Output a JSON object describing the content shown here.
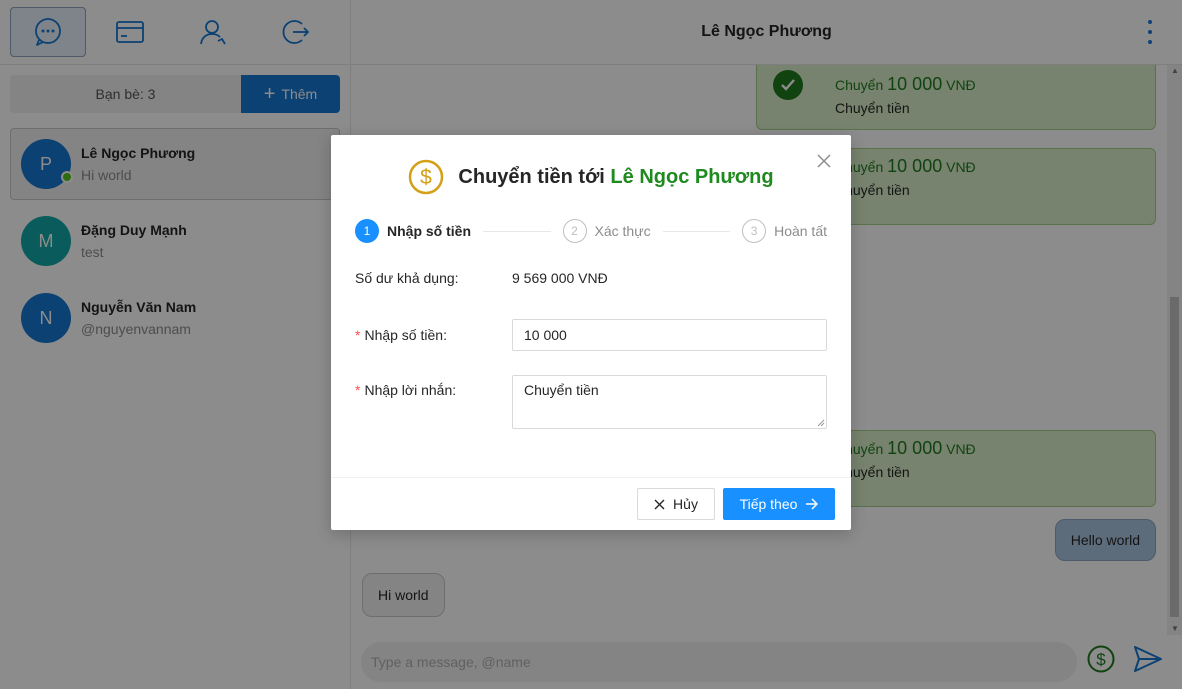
{
  "sidebar": {
    "friends_label": "Bạn bè: 3",
    "add_label": "Thêm",
    "contacts": [
      {
        "initial": "P",
        "name": "Lê Ngọc Phương",
        "sub": "Hi world",
        "color": "#1677d2",
        "online": true
      },
      {
        "initial": "M",
        "name": "Đặng Duy Mạnh",
        "sub": "test",
        "color": "#13a8a8",
        "online": false
      },
      {
        "initial": "N",
        "name": "Nguyễn Văn Nam",
        "sub": "@nguyenvannam",
        "color": "#1677d2",
        "online": false
      }
    ]
  },
  "chat": {
    "title": "Lê Ngọc Phương",
    "transfers": [
      {
        "prefix": "Chuyển",
        "amount": "10 000",
        "currency": "VNĐ",
        "note": "Chuyển tiền"
      },
      {
        "prefix": "Chuyển",
        "amount": "10 000",
        "currency": "VNĐ",
        "note": "Chuyển tiền"
      },
      {
        "prefix": "Chuyển",
        "amount": "10 000",
        "currency": "VNĐ",
        "note": "Chuyển tiền"
      }
    ],
    "bubble_right": "Hello world",
    "bubble_left": "Hi world",
    "composer_placeholder": "Type a message, @name"
  },
  "modal": {
    "title_prefix": "Chuyển tiền tới",
    "recipient": "Lê Ngọc Phương",
    "steps": [
      {
        "num": "1",
        "label": "Nhập số tiền"
      },
      {
        "num": "2",
        "label": "Xác thực"
      },
      {
        "num": "3",
        "label": "Hoàn tất"
      }
    ],
    "balance_label": "Số dư khả dụng",
    "balance_value": "9 569 000 VNĐ",
    "amount_label": "Nhập số tiền",
    "amount_value": "10 000",
    "message_label": "Nhập lời nhắn",
    "message_value": "Chuyển tiền",
    "cancel_label": "Hủy",
    "next_label": "Tiếp theo"
  },
  "colors": {
    "primary": "#1890ff",
    "nav_blue": "#1677d2",
    "success_green": "#1f7a1f",
    "gold": "#d4a017"
  }
}
